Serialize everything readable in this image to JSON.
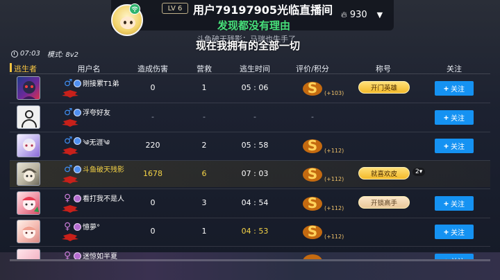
{
  "stream": {
    "level": "LV 6",
    "streamer": "用户79197905光临直播间",
    "hot_count": "930",
    "line_green": "发现都没有理由",
    "line_ghost": "斗鱼破天残影：马瑞也失手了",
    "line_white": "现在我拥有的全部一切"
  },
  "match": {
    "time": "07:03",
    "mode": "模式: 8v2"
  },
  "columns": {
    "survivor": "逃生者",
    "username": "用户名",
    "damage": "造成伤害",
    "rescue": "营救",
    "escape_time": "逃生时间",
    "rating": "评价/积分",
    "title": "称号",
    "follow": "关注"
  },
  "rows": [
    {
      "gender": "♂",
      "name": "刚接累T1弟",
      "damage": "0",
      "rescue": "1",
      "time": "05 : 06",
      "points": "(+103)",
      "title": "开门英雄",
      "follow": "关注"
    },
    {
      "gender": "♂",
      "name": "浮夸好友",
      "damage": "-",
      "rescue": "-",
      "time": "-",
      "points": "-",
      "title": "",
      "follow": "关注"
    },
    {
      "gender": "♂",
      "name": "༄无涯༄",
      "damage": "220",
      "rescue": "2",
      "time": "05 : 58",
      "points": "(+112)",
      "title": "",
      "follow": "关注"
    },
    {
      "gender": "♂",
      "name": "斗鱼破天残影",
      "damage": "1678",
      "rescue": "6",
      "time": "07 : 03",
      "points": "(+112)",
      "title": "就喜欢皮",
      "title_more": "2▾",
      "follow": ""
    },
    {
      "gender": "♀",
      "name": "看打我不是人",
      "damage": "0",
      "rescue": "3",
      "time": "04 : 54",
      "points": "(+112)",
      "title": "开锁高手",
      "follow": "关注"
    },
    {
      "gender": "♀",
      "name": "憶夢°",
      "damage": "0",
      "rescue": "1",
      "time": "04 : 53",
      "points": "(+112)",
      "title": "",
      "follow": "关注"
    },
    {
      "gender": "♀",
      "name": "迷惊如半夏",
      "damage": "",
      "rescue": "",
      "time": "",
      "points": "",
      "title": "",
      "follow": "关注"
    }
  ],
  "colors": {
    "accent_gold": "#f6c542",
    "follow_blue": "#1592f2",
    "green_text": "#47e07a"
  }
}
